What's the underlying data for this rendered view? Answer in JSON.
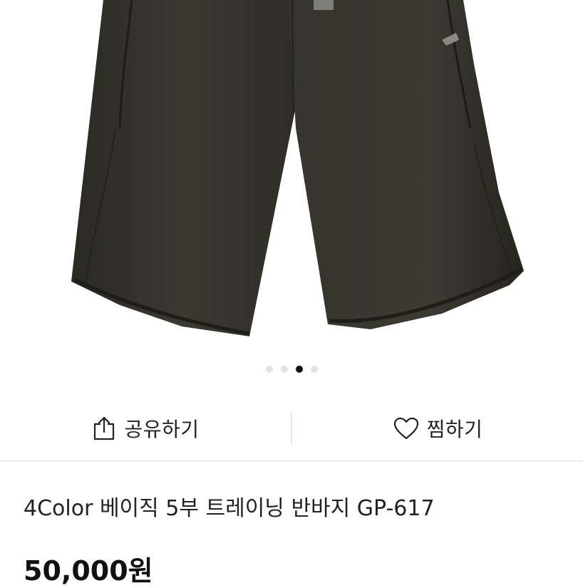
{
  "carousel": {
    "image": "black-shorts-photo",
    "slide_count": 4,
    "active_index": 2
  },
  "actions": {
    "share": {
      "icon": "share-icon",
      "label": "공유하기"
    },
    "wish": {
      "icon": "heart-icon",
      "label": "찜하기"
    }
  },
  "product": {
    "title": "4Color 베이직 5부 트레이닝 반바지 GP-617",
    "price": "50,000원"
  }
}
